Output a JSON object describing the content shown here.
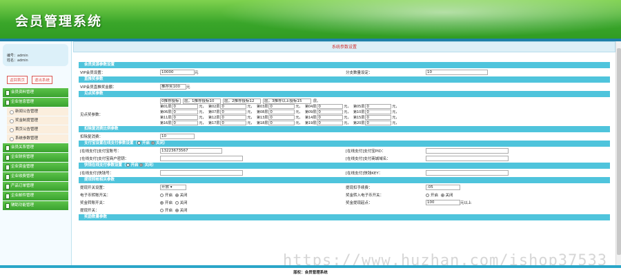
{
  "app": {
    "title": "会员管理系统"
  },
  "user": {
    "id_line": "编号：admin",
    "name_line": "姓名：admin"
  },
  "buttons": {
    "home": "返回首页",
    "logout": "退出系统"
  },
  "menu": [
    {
      "label": "会员资料管理"
    },
    {
      "label": "企业信息管理",
      "children": [
        "新闻公告管理",
        "奖金制度管理",
        "首页公告管理",
        "系统参数管理"
      ]
    },
    {
      "label": "会员关系管理"
    },
    {
      "label": "企业财务管理"
    },
    {
      "label": "企业资金管理"
    },
    {
      "label": "企业收费管理"
    },
    {
      "label": "产品订单管理"
    },
    {
      "label": "企业邮件管理"
    },
    {
      "label": "辅助功能管理"
    }
  ],
  "page": {
    "title": "系统参数设置"
  },
  "sections": {
    "basic": "会员资源参数设置",
    "tiered": "直推奖参数",
    "points": "见点奖参数",
    "deduct": "扣除复消费比例参数",
    "online1": "支付宝设置在线支付参数设置（",
    "online2": "快钱在线支付参数设置（",
    "withdraw": "提现转帐相关参数",
    "more": "奖励数量参数"
  },
  "fields": {
    "vip_label": "VIP会员设置：",
    "vip_value": "10000",
    "vip_unit": "元",
    "split_label": "分支数量设定：",
    "split_value": "10",
    "direct_label": "VIP会员直推奖金额：",
    "direct_value": "推荐奖100",
    "direct_unit": "元",
    "points_label": "见点奖参数：",
    "points_top": [
      "0推荐投标",
      "层，1推荐投标10",
      "层，2推荐投标12",
      "层，3推荐以上投标15",
      "层。"
    ],
    "deduct_label": "扣除复消费：",
    "deduct_value": "10",
    "alipay_account_label": "[在线支付]支付宝账号：",
    "alipay_account_value": "13223673567",
    "alipay_pid_label": "[在线支付]支付宝PID：",
    "alipay_key_label": "[在线支付]支付宝商户密钥：",
    "alipay_mail_label": "[在线支付]支付商城域名：",
    "kq_label1": "[在线支付]快钱号：",
    "kq_label2": "[在线支付]快钱KEY：",
    "withdraw_switch_label": "提现开关设置：",
    "withdraw_switch_value": "开放",
    "fee_label": "提现扣手续费：",
    "fee_value": ".05",
    "ebank_label": "电子币转账开关：",
    "bonus_label": "奖金转入电子币开关：",
    "transfer_label": "奖金转账开关：",
    "min_label": "奖金提现起点：",
    "min_value": "100",
    "min_unit": "元以上",
    "withdraw_open_label": "提现开关："
  },
  "radio": {
    "open": "开启",
    "close": "关闭",
    "close_paren": "关闭）"
  },
  "grid_rows": [
    [
      "第01层",
      "第02层",
      "第03层",
      "第04层",
      "第05层"
    ],
    [
      "第06层",
      "第07层",
      "第08层",
      "第09层",
      "第10层"
    ],
    [
      "第11层",
      "第12层",
      "第13层",
      "第14层",
      "第15层"
    ],
    [
      "第16层",
      "第17层",
      "第18层",
      "第19层",
      "第20层"
    ]
  ],
  "grid_value": "0",
  "grid_unit": "元，",
  "footer": {
    "text": "版权：会员管理系统"
  },
  "watermark": "https://www.huzhan.com/ishop37533"
}
